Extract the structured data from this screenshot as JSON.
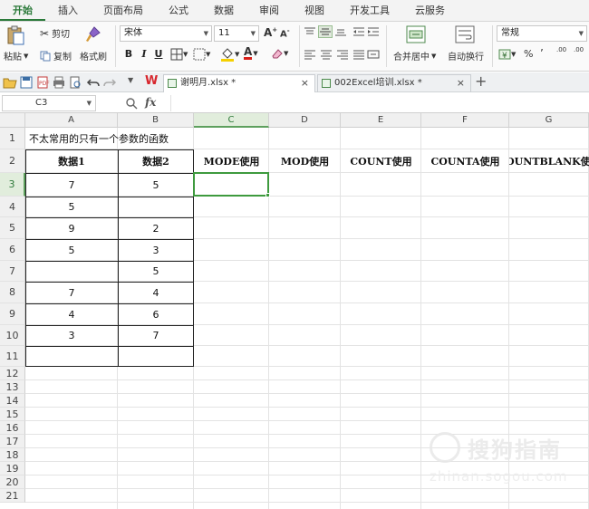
{
  "menu": {
    "tabs": [
      "开始",
      "插入",
      "页面布局",
      "公式",
      "数据",
      "审阅",
      "视图",
      "开发工具",
      "云服务"
    ],
    "active_index": 0
  },
  "ribbon": {
    "paste_label": "粘贴",
    "cut_label": "剪切",
    "copy_label": "复制",
    "format_painter_label": "格式刷",
    "font_name": "宋体",
    "font_size": "11",
    "bold": "B",
    "italic": "I",
    "underline": "U",
    "merge_center_label": "合并居中",
    "wrap_text_label": "自动换行",
    "number_format": "常规",
    "percent": "%",
    "thousands": "’",
    "increase_decimal": ".00",
    "decrease_decimal": ".00"
  },
  "tabs": [
    {
      "label": "谢明月.xlsx *",
      "active": true
    },
    {
      "label": "002Excel培训.xlsx *",
      "active": false
    }
  ],
  "formula_bar": {
    "cell_ref": "C3",
    "fx": "fx",
    "value": ""
  },
  "sheet": {
    "columns": [
      "A",
      "B",
      "C",
      "D",
      "E",
      "F",
      "G"
    ],
    "selected_column": "C",
    "selected_row": 3,
    "rows": [
      1,
      2,
      3,
      4,
      5,
      6,
      7,
      8,
      9,
      10,
      11,
      12,
      13,
      14,
      15,
      16,
      17,
      18,
      19,
      20,
      21
    ],
    "title_cell": "不太常用的只有一个参数的函数",
    "header_row": [
      "数据1",
      "数据2",
      "MODE使用",
      "MOD使用",
      "COUNT使用",
      "COUNTA使用",
      "COUNTBLANK使用"
    ],
    "data1": [
      "7",
      "5",
      "9",
      "5",
      "",
      "7",
      "4",
      "3",
      ""
    ],
    "data2": [
      "5",
      "",
      "2",
      "3",
      "5",
      "4",
      "6",
      "7",
      ""
    ]
  },
  "watermark": {
    "text": "搜狗指南",
    "url": "zhinan.sogou.com"
  }
}
